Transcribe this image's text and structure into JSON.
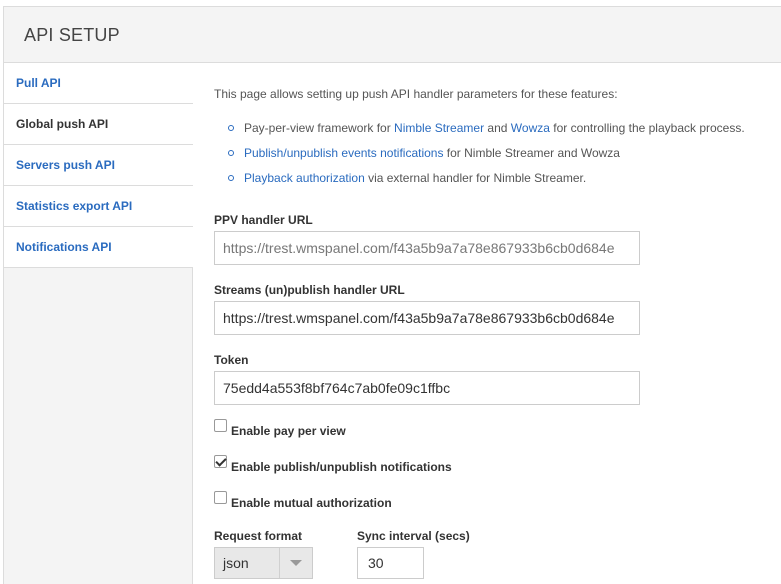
{
  "header": {
    "title": "API SETUP"
  },
  "sidebar": {
    "items": [
      {
        "label": "Pull API",
        "active": false
      },
      {
        "label": "Global push API",
        "active": true
      },
      {
        "label": "Servers push API",
        "active": false
      },
      {
        "label": "Statistics export API",
        "active": false
      },
      {
        "label": "Notifications API",
        "active": false
      }
    ]
  },
  "main": {
    "intro": "This page allows setting up push API handler parameters for these features:",
    "bullets": [
      {
        "t1": "Pay-per-view framework for ",
        "link1": "Nimble Streamer",
        "t2": " and ",
        "link2": "Wowza",
        "t3": " for controlling the playback process."
      },
      {
        "link1": "Publish/unpublish events notifications",
        "t1": " for Nimble Streamer and Wowza"
      },
      {
        "link1": "Playback authorization",
        "t1": " via external handler for Nimble Streamer."
      }
    ],
    "ppv": {
      "label": "PPV handler URL",
      "value": "https://trest.wmspanel.com/f43a5b9a7a78e867933b6cb0d684e"
    },
    "streams": {
      "label": "Streams (un)publish handler URL",
      "value": "https://trest.wmspanel.com/f43a5b9a7a78e867933b6cb0d684e"
    },
    "token": {
      "label": "Token",
      "value": "75edd4a553f8bf764c7ab0fe09c1ffbc"
    },
    "checkboxes": [
      {
        "label": "Enable pay per view",
        "checked": false
      },
      {
        "label": "Enable publish/unpublish notifications",
        "checked": true
      },
      {
        "label": "Enable mutual authorization",
        "checked": false
      }
    ],
    "request_format": {
      "label": "Request format",
      "value": "json"
    },
    "sync_interval": {
      "label": "Sync interval (secs)",
      "value": "30"
    }
  },
  "colors": {
    "link": "#2a6bbf",
    "panel_bg": "#f4f4f4",
    "border": "#dcdcdc"
  }
}
